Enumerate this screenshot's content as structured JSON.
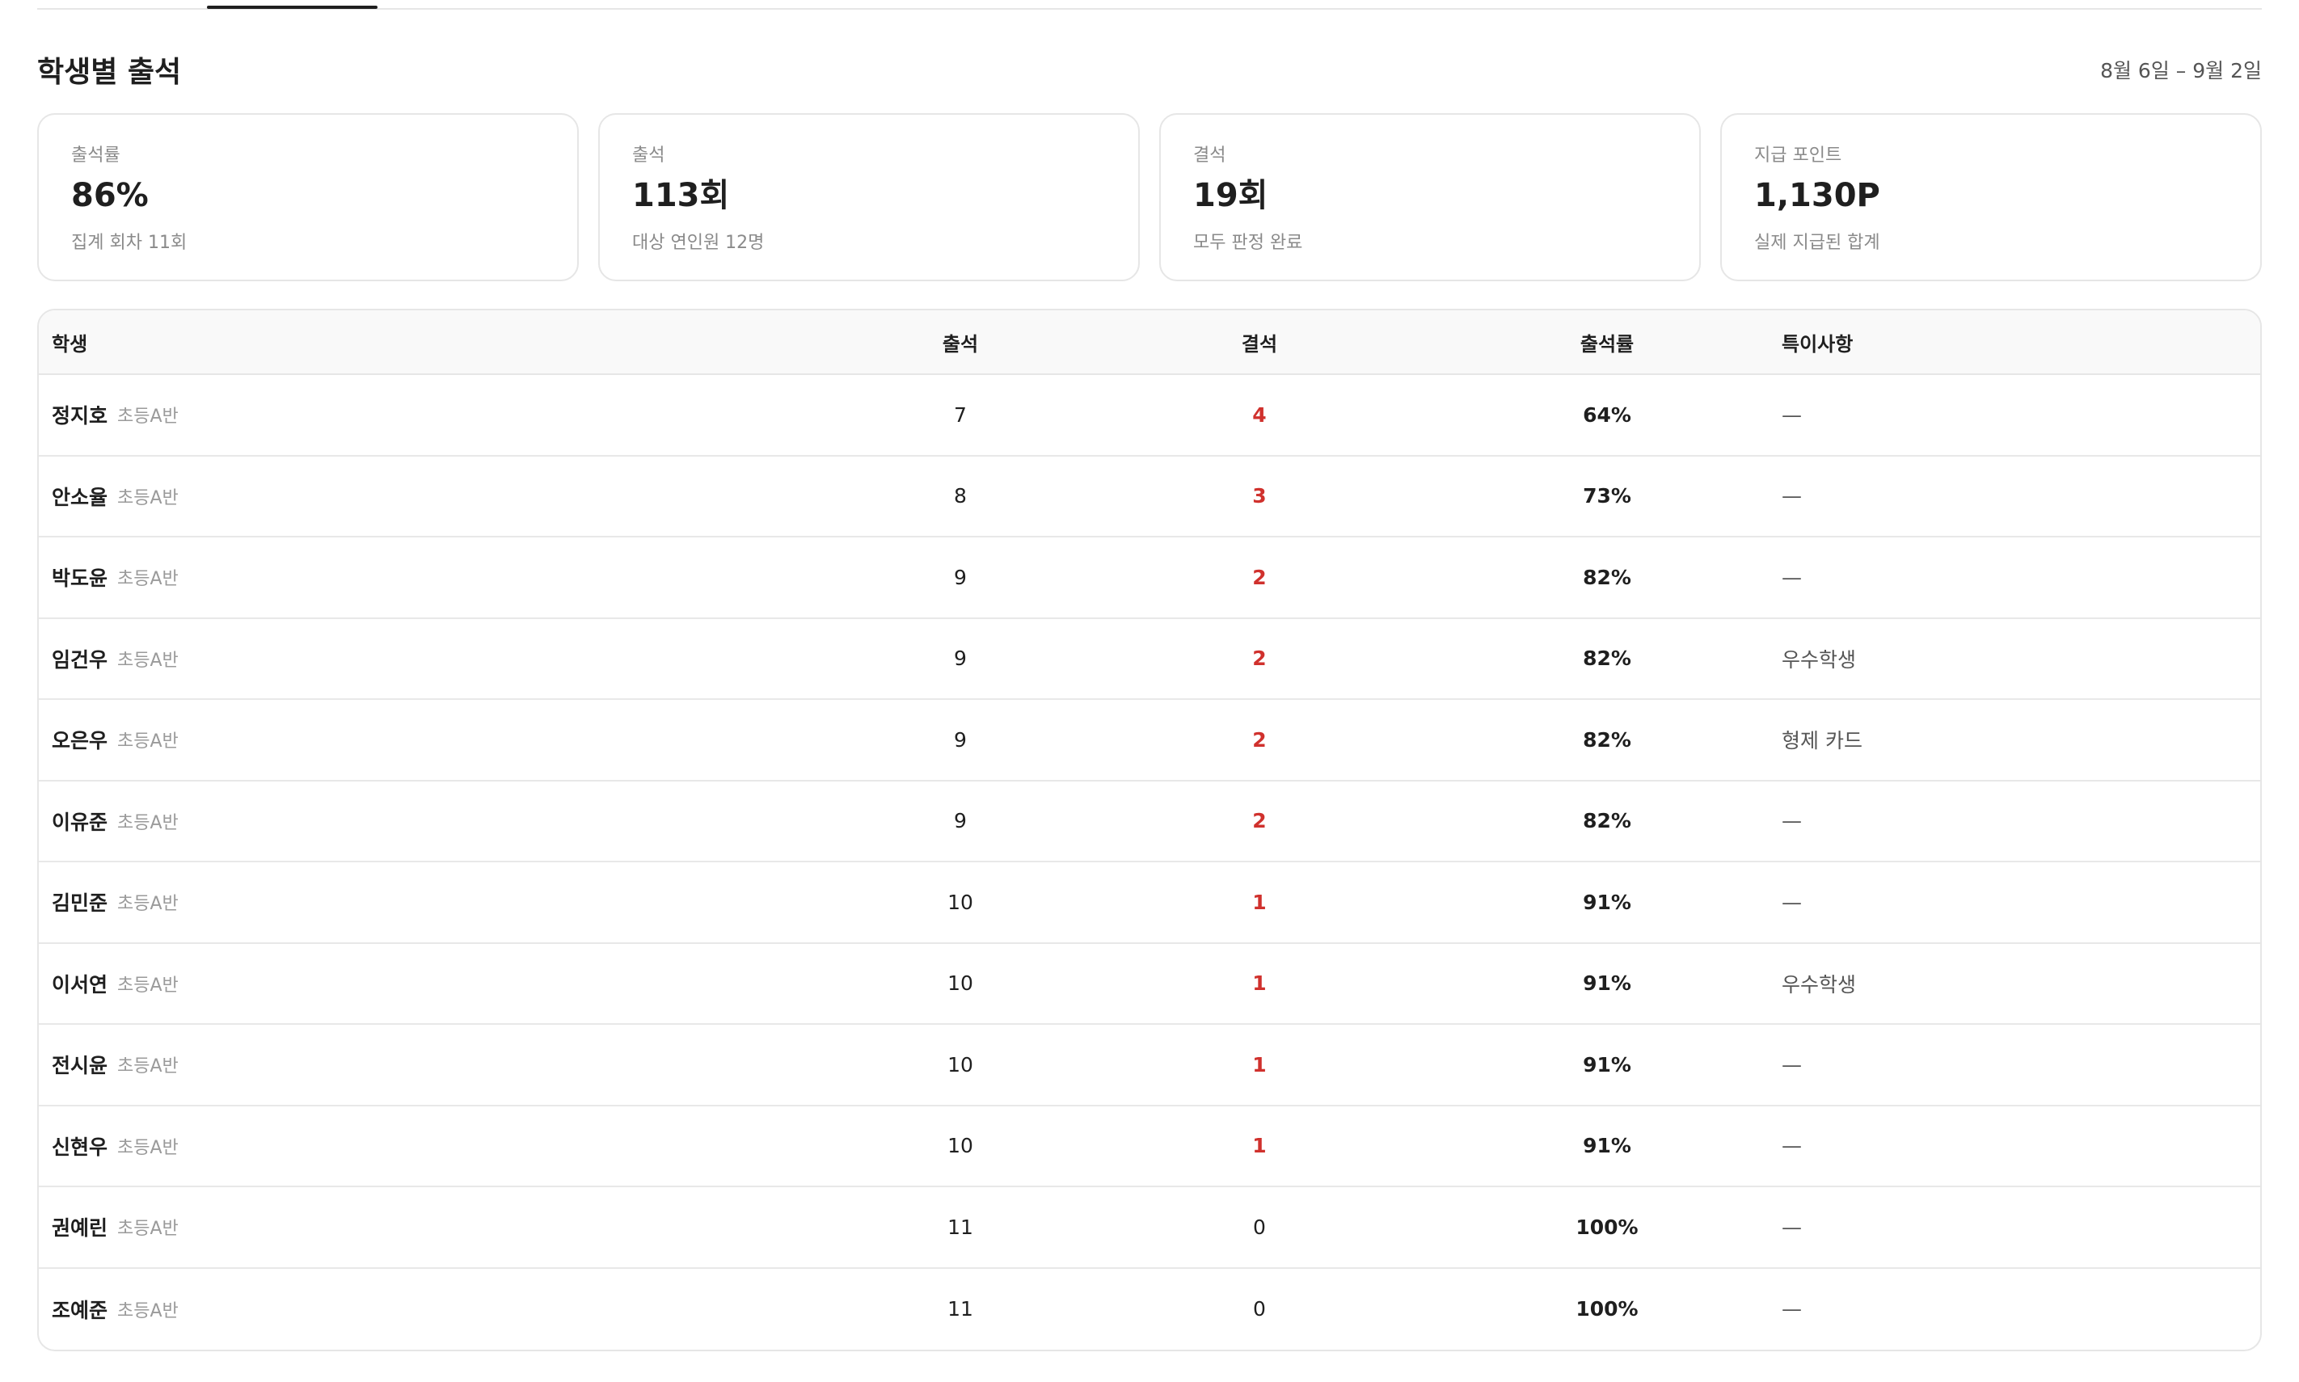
{
  "section": {
    "title": "학생별 출석",
    "date_range": "8월 6일 – 9월 2일"
  },
  "cards": [
    {
      "label": "출석률",
      "value": "86%",
      "sub": "집계 회차 11회"
    },
    {
      "label": "출석",
      "value": "113회",
      "sub": "대상 연인원 12명"
    },
    {
      "label": "결석",
      "value": "19회",
      "sub": "모두 판정 완료"
    },
    {
      "label": "지급 포인트",
      "value": "1,130P",
      "sub": "실제 지급된 합계"
    }
  ],
  "table": {
    "headers": {
      "student": "학생",
      "attendance": "출석",
      "absence": "결석",
      "rate": "출석률",
      "note": "특이사항"
    },
    "rows": [
      {
        "name": "정지호",
        "class": "초등A반",
        "attendance": "7",
        "absence": "4",
        "rate": "64%",
        "note": "—"
      },
      {
        "name": "안소율",
        "class": "초등A반",
        "attendance": "8",
        "absence": "3",
        "rate": "73%",
        "note": "—"
      },
      {
        "name": "박도윤",
        "class": "초등A반",
        "attendance": "9",
        "absence": "2",
        "rate": "82%",
        "note": "—"
      },
      {
        "name": "임건우",
        "class": "초등A반",
        "attendance": "9",
        "absence": "2",
        "rate": "82%",
        "note": "우수학생"
      },
      {
        "name": "오은우",
        "class": "초등A반",
        "attendance": "9",
        "absence": "2",
        "rate": "82%",
        "note": "형제 카드"
      },
      {
        "name": "이유준",
        "class": "초등A반",
        "attendance": "9",
        "absence": "2",
        "rate": "82%",
        "note": "—"
      },
      {
        "name": "김민준",
        "class": "초등A반",
        "attendance": "10",
        "absence": "1",
        "rate": "91%",
        "note": "—"
      },
      {
        "name": "이서연",
        "class": "초등A반",
        "attendance": "10",
        "absence": "1",
        "rate": "91%",
        "note": "우수학생"
      },
      {
        "name": "전시윤",
        "class": "초등A반",
        "attendance": "10",
        "absence": "1",
        "rate": "91%",
        "note": "—"
      },
      {
        "name": "신현우",
        "class": "초등A반",
        "attendance": "10",
        "absence": "1",
        "rate": "91%",
        "note": "—"
      },
      {
        "name": "권예린",
        "class": "초등A반",
        "attendance": "11",
        "absence": "0",
        "rate": "100%",
        "note": "—"
      },
      {
        "name": "조예준",
        "class": "초등A반",
        "attendance": "11",
        "absence": "0",
        "rate": "100%",
        "note": "—"
      }
    ]
  },
  "colors": {
    "absence_highlight": "#d0312d",
    "border": "#e6e6e6",
    "header_bg": "#f9f9f9"
  }
}
